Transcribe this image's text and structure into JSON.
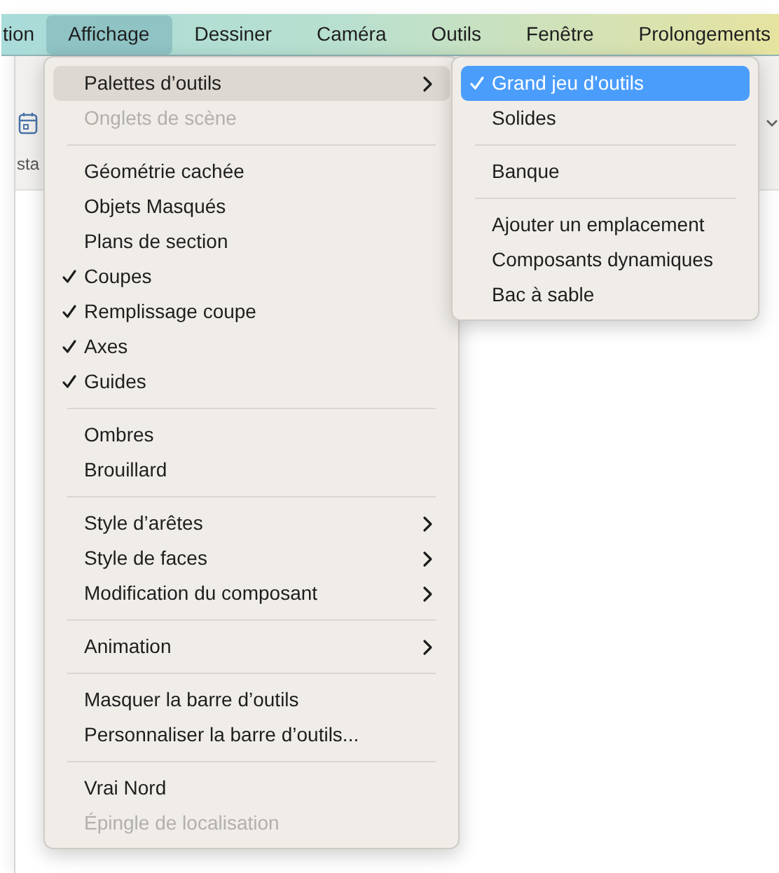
{
  "menubar": [
    {
      "label": "tion",
      "selected": false
    },
    {
      "label": "Affichage",
      "selected": true
    },
    {
      "label": "Dessiner",
      "selected": false
    },
    {
      "label": "Caméra",
      "selected": false
    },
    {
      "label": "Outils",
      "selected": false
    },
    {
      "label": "Fenêtre",
      "selected": false
    },
    {
      "label": "Prolongements",
      "selected": false
    }
  ],
  "toolbar": {
    "label": "sta"
  },
  "menu": [
    {
      "kind": "item",
      "label": "Palettes d’outils",
      "checked": false,
      "disabled": false,
      "submenu": true,
      "selected": true
    },
    {
      "kind": "item",
      "label": "Onglets de scène",
      "checked": false,
      "disabled": true,
      "submenu": false,
      "selected": false
    },
    {
      "kind": "separator"
    },
    {
      "kind": "item",
      "label": "Géométrie cachée",
      "checked": false,
      "disabled": false,
      "submenu": false,
      "selected": false
    },
    {
      "kind": "item",
      "label": "Objets Masqués",
      "checked": false,
      "disabled": false,
      "submenu": false,
      "selected": false
    },
    {
      "kind": "item",
      "label": "Plans de section",
      "checked": false,
      "disabled": false,
      "submenu": false,
      "selected": false
    },
    {
      "kind": "item",
      "label": "Coupes",
      "checked": true,
      "disabled": false,
      "submenu": false,
      "selected": false
    },
    {
      "kind": "item",
      "label": "Remplissage coupe",
      "checked": true,
      "disabled": false,
      "submenu": false,
      "selected": false
    },
    {
      "kind": "item",
      "label": "Axes",
      "checked": true,
      "disabled": false,
      "submenu": false,
      "selected": false
    },
    {
      "kind": "item",
      "label": "Guides",
      "checked": true,
      "disabled": false,
      "submenu": false,
      "selected": false
    },
    {
      "kind": "separator"
    },
    {
      "kind": "item",
      "label": "Ombres",
      "checked": false,
      "disabled": false,
      "submenu": false,
      "selected": false
    },
    {
      "kind": "item",
      "label": "Brouillard",
      "checked": false,
      "disabled": false,
      "submenu": false,
      "selected": false
    },
    {
      "kind": "separator"
    },
    {
      "kind": "item",
      "label": "Style d’arêtes",
      "checked": false,
      "disabled": false,
      "submenu": true,
      "selected": false
    },
    {
      "kind": "item",
      "label": "Style de faces",
      "checked": false,
      "disabled": false,
      "submenu": true,
      "selected": false
    },
    {
      "kind": "item",
      "label": "Modification du composant",
      "checked": false,
      "disabled": false,
      "submenu": true,
      "selected": false
    },
    {
      "kind": "separator"
    },
    {
      "kind": "item",
      "label": "Animation",
      "checked": false,
      "disabled": false,
      "submenu": true,
      "selected": false
    },
    {
      "kind": "separator"
    },
    {
      "kind": "item",
      "label": "Masquer la barre d’outils",
      "checked": false,
      "disabled": false,
      "submenu": false,
      "selected": false
    },
    {
      "kind": "item",
      "label": "Personnaliser la barre d’outils...",
      "checked": false,
      "disabled": false,
      "submenu": false,
      "selected": false
    },
    {
      "kind": "separator"
    },
    {
      "kind": "item",
      "label": "Vrai Nord",
      "checked": false,
      "disabled": false,
      "submenu": false,
      "selected": false
    },
    {
      "kind": "item",
      "label": "Épingle de localisation",
      "checked": false,
      "disabled": true,
      "submenu": false,
      "selected": false
    }
  ],
  "submenu": [
    {
      "kind": "item",
      "label": "Grand jeu d'outils",
      "checked": true,
      "disabled": false,
      "submenu": false,
      "selected": true
    },
    {
      "kind": "item",
      "label": "Solides",
      "checked": false,
      "disabled": false,
      "submenu": false,
      "selected": false
    },
    {
      "kind": "separator"
    },
    {
      "kind": "item",
      "label": "Banque",
      "checked": false,
      "disabled": false,
      "submenu": false,
      "selected": false
    },
    {
      "kind": "separator"
    },
    {
      "kind": "item",
      "label": "Ajouter un emplacement",
      "checked": false,
      "disabled": false,
      "submenu": false,
      "selected": false
    },
    {
      "kind": "item",
      "label": "Composants dynamiques",
      "checked": false,
      "disabled": false,
      "submenu": false,
      "selected": false
    },
    {
      "kind": "item",
      "label": "Bac à sable",
      "checked": false,
      "disabled": false,
      "submenu": false,
      "selected": false
    }
  ]
}
